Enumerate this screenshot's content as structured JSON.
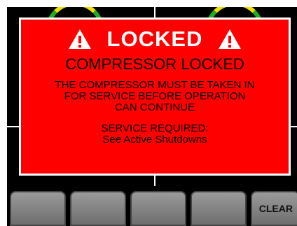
{
  "alert": {
    "title": "LOCKED",
    "headline": "COMPRESSOR LOCKED",
    "message_lines": [
      "THE COMPRESSOR MUST BE TAKEN IN",
      "FOR SERVICE BEFORE OPERATION",
      "CAN CONTINUE"
    ],
    "service_lines": [
      "SERVICE REQUIRED:",
      "See Active Shutdowns"
    ],
    "icon": "warning-triangle-icon",
    "colors": {
      "background": "#ff0000",
      "title_text": "#ffffff",
      "body_text": "#000000"
    }
  },
  "softkeys": [
    {
      "label": ""
    },
    {
      "label": ""
    },
    {
      "label": ""
    },
    {
      "label": ""
    },
    {
      "label": "CLEAR"
    }
  ]
}
